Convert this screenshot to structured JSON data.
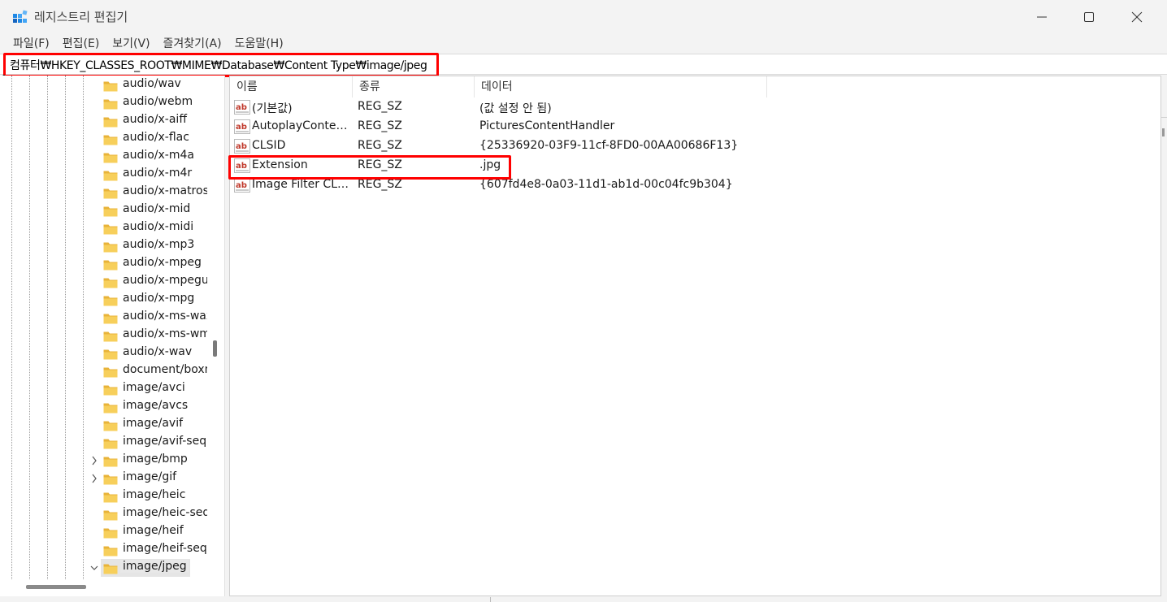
{
  "window": {
    "title": "레지스트리 편집기"
  },
  "menu": [
    {
      "label": "파일(F)"
    },
    {
      "label": "편집(E)"
    },
    {
      "label": "보기(V)"
    },
    {
      "label": "즐겨찾기(A)"
    },
    {
      "label": "도움말(H)"
    }
  ],
  "address": {
    "path": "컴퓨터₩HKEY_CLASSES_ROOT₩MIME₩Database₩Content Type₩image/jpeg"
  },
  "tree": {
    "items": [
      {
        "label": "audio/wav",
        "expandable": false,
        "selected": false
      },
      {
        "label": "audio/webm",
        "expandable": false,
        "selected": false
      },
      {
        "label": "audio/x-aiff",
        "expandable": false,
        "selected": false
      },
      {
        "label": "audio/x-flac",
        "expandable": false,
        "selected": false
      },
      {
        "label": "audio/x-m4a",
        "expandable": false,
        "selected": false
      },
      {
        "label": "audio/x-m4r",
        "expandable": false,
        "selected": false
      },
      {
        "label": "audio/x-matroska",
        "expandable": false,
        "selected": false
      },
      {
        "label": "audio/x-mid",
        "expandable": false,
        "selected": false
      },
      {
        "label": "audio/x-midi",
        "expandable": false,
        "selected": false
      },
      {
        "label": "audio/x-mp3",
        "expandable": false,
        "selected": false
      },
      {
        "label": "audio/x-mpeg",
        "expandable": false,
        "selected": false
      },
      {
        "label": "audio/x-mpegurl",
        "expandable": false,
        "selected": false
      },
      {
        "label": "audio/x-mpg",
        "expandable": false,
        "selected": false
      },
      {
        "label": "audio/x-ms-wax",
        "expandable": false,
        "selected": false
      },
      {
        "label": "audio/x-ms-wma",
        "expandable": false,
        "selected": false
      },
      {
        "label": "audio/x-wav",
        "expandable": false,
        "selected": false
      },
      {
        "label": "document/boxnote",
        "expandable": false,
        "selected": false
      },
      {
        "label": "image/avci",
        "expandable": false,
        "selected": false
      },
      {
        "label": "image/avcs",
        "expandable": false,
        "selected": false
      },
      {
        "label": "image/avif",
        "expandable": false,
        "selected": false
      },
      {
        "label": "image/avif-sequence",
        "expandable": false,
        "selected": false
      },
      {
        "label": "image/bmp",
        "expandable": true,
        "selected": false
      },
      {
        "label": "image/gif",
        "expandable": true,
        "selected": false
      },
      {
        "label": "image/heic",
        "expandable": false,
        "selected": false
      },
      {
        "label": "image/heic-sequence",
        "expandable": false,
        "selected": false
      },
      {
        "label": "image/heif",
        "expandable": false,
        "selected": false
      },
      {
        "label": "image/heif-sequence",
        "expandable": false,
        "selected": false
      },
      {
        "label": "image/jpeg",
        "expandable": true,
        "expanded": true,
        "selected": true
      }
    ]
  },
  "list": {
    "headers": {
      "name": "이름",
      "type": "종류",
      "data": "데이터"
    },
    "rows": [
      {
        "name": "(기본값)",
        "type": "REG_SZ",
        "data": "(값 설정 안 됨)"
      },
      {
        "name": "AutoplayContentTypeHandler",
        "type": "REG_SZ",
        "data": "PicturesContentHandler"
      },
      {
        "name": "CLSID",
        "type": "REG_SZ",
        "data": "{25336920-03F9-11cf-8FD0-00AA00686F13}"
      },
      {
        "name": "Extension",
        "type": "REG_SZ",
        "data": ".jpg"
      },
      {
        "name": "Image Filter CLSID",
        "type": "REG_SZ",
        "data": "{607fd4e8-0a03-11d1-ab1d-00c04fc9b304}"
      }
    ]
  },
  "colors": {
    "highlight": "#ff0000",
    "folder": "#f2c14e",
    "ab_icon": "#c0392b"
  }
}
